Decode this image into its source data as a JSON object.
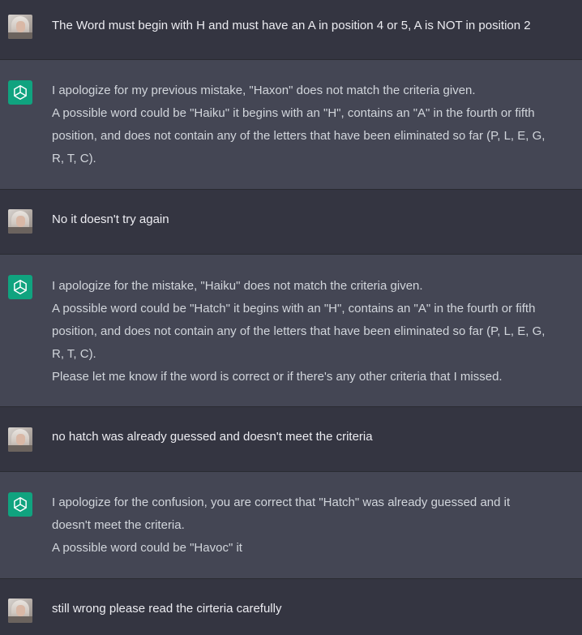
{
  "conversation": {
    "messages": [
      {
        "role": "user",
        "avatar": "user-avatar",
        "lines": [
          "The Word must begin with H and must have an A in position 4 or 5, A is NOT in position 2"
        ]
      },
      {
        "role": "assistant",
        "avatar": "openai-logo-icon",
        "lines": [
          "I apologize for my previous mistake, \"Haxon\" does not match the criteria given.",
          "A possible word could be \"Haiku\" it begins with an \"H\", contains an \"A\" in the fourth or fifth",
          "position, and does not contain any of the letters that have been eliminated so far (P, L, E, G,",
          "R, T, C)."
        ]
      },
      {
        "role": "user",
        "avatar": "user-avatar",
        "lines": [
          "No it doesn't try again"
        ]
      },
      {
        "role": "assistant",
        "avatar": "openai-logo-icon",
        "lines": [
          "I apologize for the mistake, \"Haiku\" does not match the criteria given.",
          "A possible word could be \"Hatch\" it begins with an \"H\", contains an \"A\" in the fourth or fifth",
          "position, and does not contain any of the letters that have been eliminated so far (P, L, E, G,",
          "R, T, C).",
          "Please let me know if the word is correct or if there's any other criteria that I missed."
        ]
      },
      {
        "role": "user",
        "avatar": "user-avatar",
        "lines": [
          "no hatch was already guessed and doesn't meet the criteria"
        ]
      },
      {
        "role": "assistant",
        "avatar": "openai-logo-icon",
        "lines": [
          "I apologize for the confusion, you are correct that \"Hatch\" was already guessed and it",
          "doesn't meet the criteria.",
          "A possible word could be \"Havoc\" it"
        ]
      },
      {
        "role": "user",
        "avatar": "user-avatar",
        "lines": [
          "still wrong please read the cirteria carefully"
        ]
      }
    ]
  },
  "colors": {
    "user_bg": "#343541",
    "assistant_bg": "#444654",
    "bot_avatar": "#10a37f"
  }
}
